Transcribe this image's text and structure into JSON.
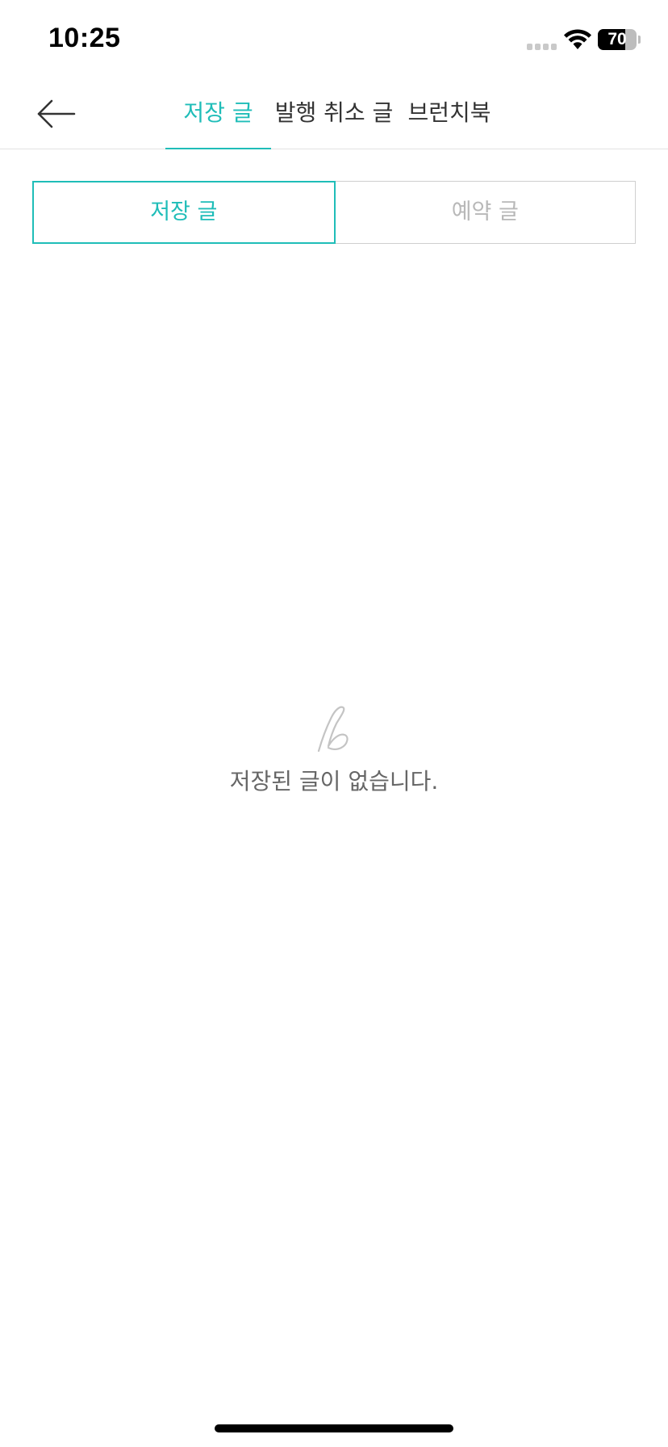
{
  "status_bar": {
    "time": "10:25",
    "battery_percent": 70,
    "battery_label": "70"
  },
  "icons": {
    "back": "arrow-left-icon",
    "wifi": "wifi-icon",
    "empty": "brunch-b-icon"
  },
  "tabs": [
    {
      "label": "저장 글",
      "active": true
    },
    {
      "label": "발행 취소 글",
      "active": false
    },
    {
      "label": "브런치북",
      "active": false
    }
  ],
  "segments": [
    {
      "label": "저장 글",
      "active": true
    },
    {
      "label": "예약 글",
      "active": false
    }
  ],
  "empty_state": {
    "message": "저장된 글이 없습니다."
  },
  "colors": {
    "accent": "#1fbdb8",
    "inactive_text": "#b8b8b8",
    "body_text": "#333333"
  }
}
